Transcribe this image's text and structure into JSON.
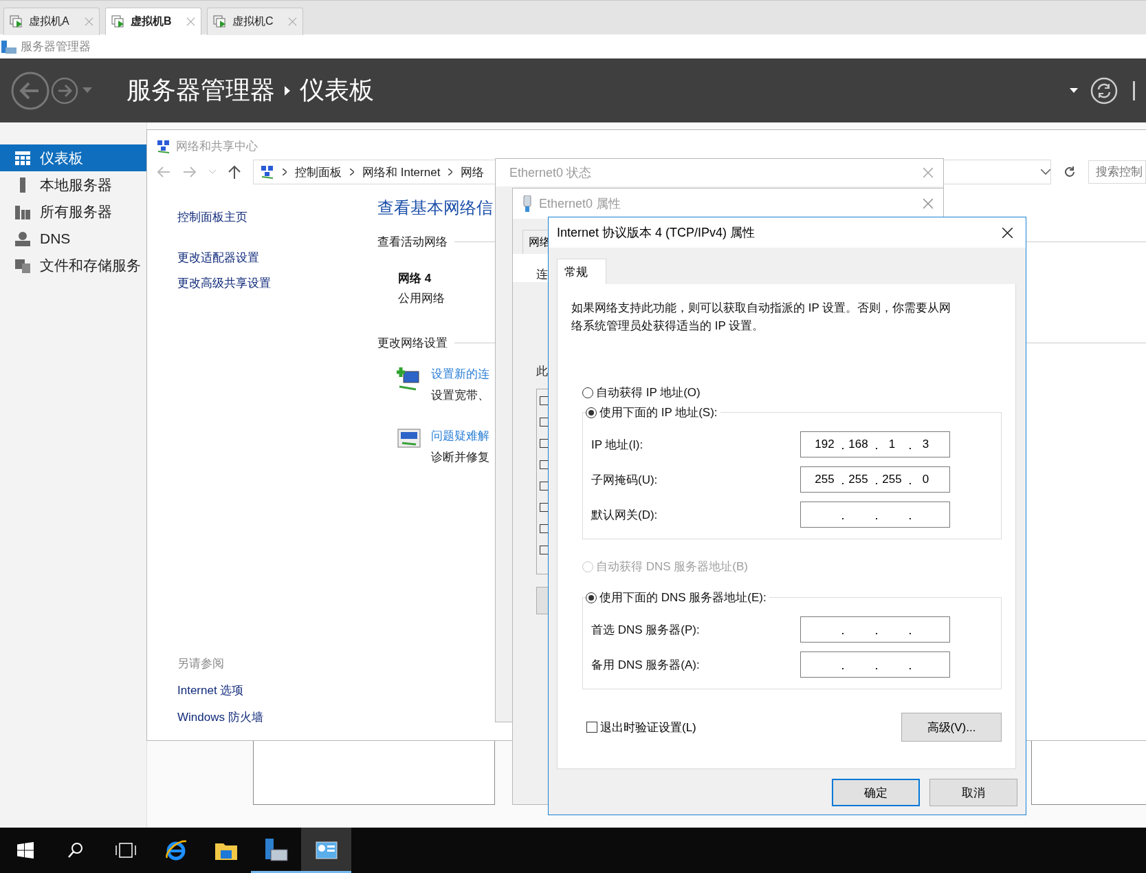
{
  "vm_tabs": [
    {
      "label": "虚拟机A",
      "selected": false
    },
    {
      "label": "虚拟机B",
      "selected": true
    },
    {
      "label": "虚拟机C",
      "selected": false
    }
  ],
  "app_title": "服务器管理器",
  "header": {
    "breadcrumb": [
      "服务器管理器",
      "仪表板"
    ]
  },
  "sidebar": {
    "items": [
      {
        "label": "仪表板",
        "kind": "dashboard",
        "selected": true
      },
      {
        "label": "本地服务器",
        "kind": "server",
        "selected": false
      },
      {
        "label": "所有服务器",
        "kind": "servers",
        "selected": false
      },
      {
        "label": "DNS",
        "kind": "dns",
        "selected": false
      },
      {
        "label": "文件和存储服务",
        "kind": "storage",
        "selected": false
      }
    ]
  },
  "network_center": {
    "title": "网络和共享中心",
    "address": [
      "控制面板",
      "网络和 Internet",
      "网络"
    ],
    "search_placeholder": "搜索控制",
    "side_links": [
      "控制面板主页",
      "更改适配器设置",
      "更改高级共享设置"
    ],
    "see_also": {
      "heading": "另请参阅",
      "links": [
        "Internet 选项",
        "Windows 防火墙"
      ]
    },
    "heading": "查看基本网络信",
    "active_networks_label": "查看活动网络",
    "network": {
      "name": "网络 4",
      "category": "公用网络"
    },
    "change_settings_label": "更改网络设置",
    "tasks": [
      {
        "kind": "new-connection",
        "title": "设置新的连",
        "desc": "设置宽带、"
      },
      {
        "kind": "troubleshoot",
        "title": "问题疑难解",
        "desc": "诊断并修复"
      }
    ]
  },
  "status_dialog": {
    "title": "Ethernet0 状态"
  },
  "properties_dialog": {
    "title": "Ethernet0 属性",
    "tab": "网络",
    "fragments": [
      "连",
      "此"
    ]
  },
  "ipv4_dialog": {
    "title": "Internet 协议版本 4 (TCP/IPv4) 属性",
    "tabs": [
      {
        "label": "常规",
        "selected": true
      }
    ],
    "description": "如果网络支持此功能，则可以获取自动指派的 IP 设置。否则，你需要从网络系统管理员处获得适当的 IP 设置。",
    "ip_mode": [
      {
        "label": "自动获得 IP 地址(O)",
        "selected": false
      },
      {
        "label": "使用下面的 IP 地址(S):",
        "selected": true
      }
    ],
    "ip_fields": [
      {
        "label": "IP 地址(I):",
        "octets": [
          "192",
          "168",
          "1",
          "3"
        ]
      },
      {
        "label": "子网掩码(U):",
        "octets": [
          "255",
          "255",
          "255",
          "0"
        ]
      },
      {
        "label": "默认网关(D):"
      }
    ],
    "dns_mode": [
      {
        "label": "自动获得 DNS 服务器地址(B)",
        "selected": false,
        "disabled": true
      },
      {
        "label": "使用下面的 DNS 服务器地址(E):",
        "selected": true,
        "disabled": false
      }
    ],
    "dns_fields": [
      {
        "label": "首选 DNS 服务器(P):"
      },
      {
        "label": "备用 DNS 服务器(A):"
      }
    ],
    "verify_on_exit": {
      "label": "退出时验证设置(L)",
      "checked": false
    },
    "advanced_button": "高级(V)...",
    "buttons": [
      {
        "label": "确定",
        "default": true
      },
      {
        "label": "取消",
        "default": false
      }
    ]
  },
  "taskbar": {
    "items": [
      {
        "kind": "start",
        "running": false,
        "selected": false
      },
      {
        "kind": "search",
        "running": false,
        "selected": false
      },
      {
        "kind": "task-view",
        "running": false,
        "selected": false
      },
      {
        "kind": "browser",
        "running": false,
        "selected": false
      },
      {
        "kind": "explorer",
        "running": false,
        "selected": false
      },
      {
        "kind": "server-manager",
        "running": true,
        "selected": false
      },
      {
        "kind": "network-app",
        "running": true,
        "selected": true
      }
    ]
  }
}
